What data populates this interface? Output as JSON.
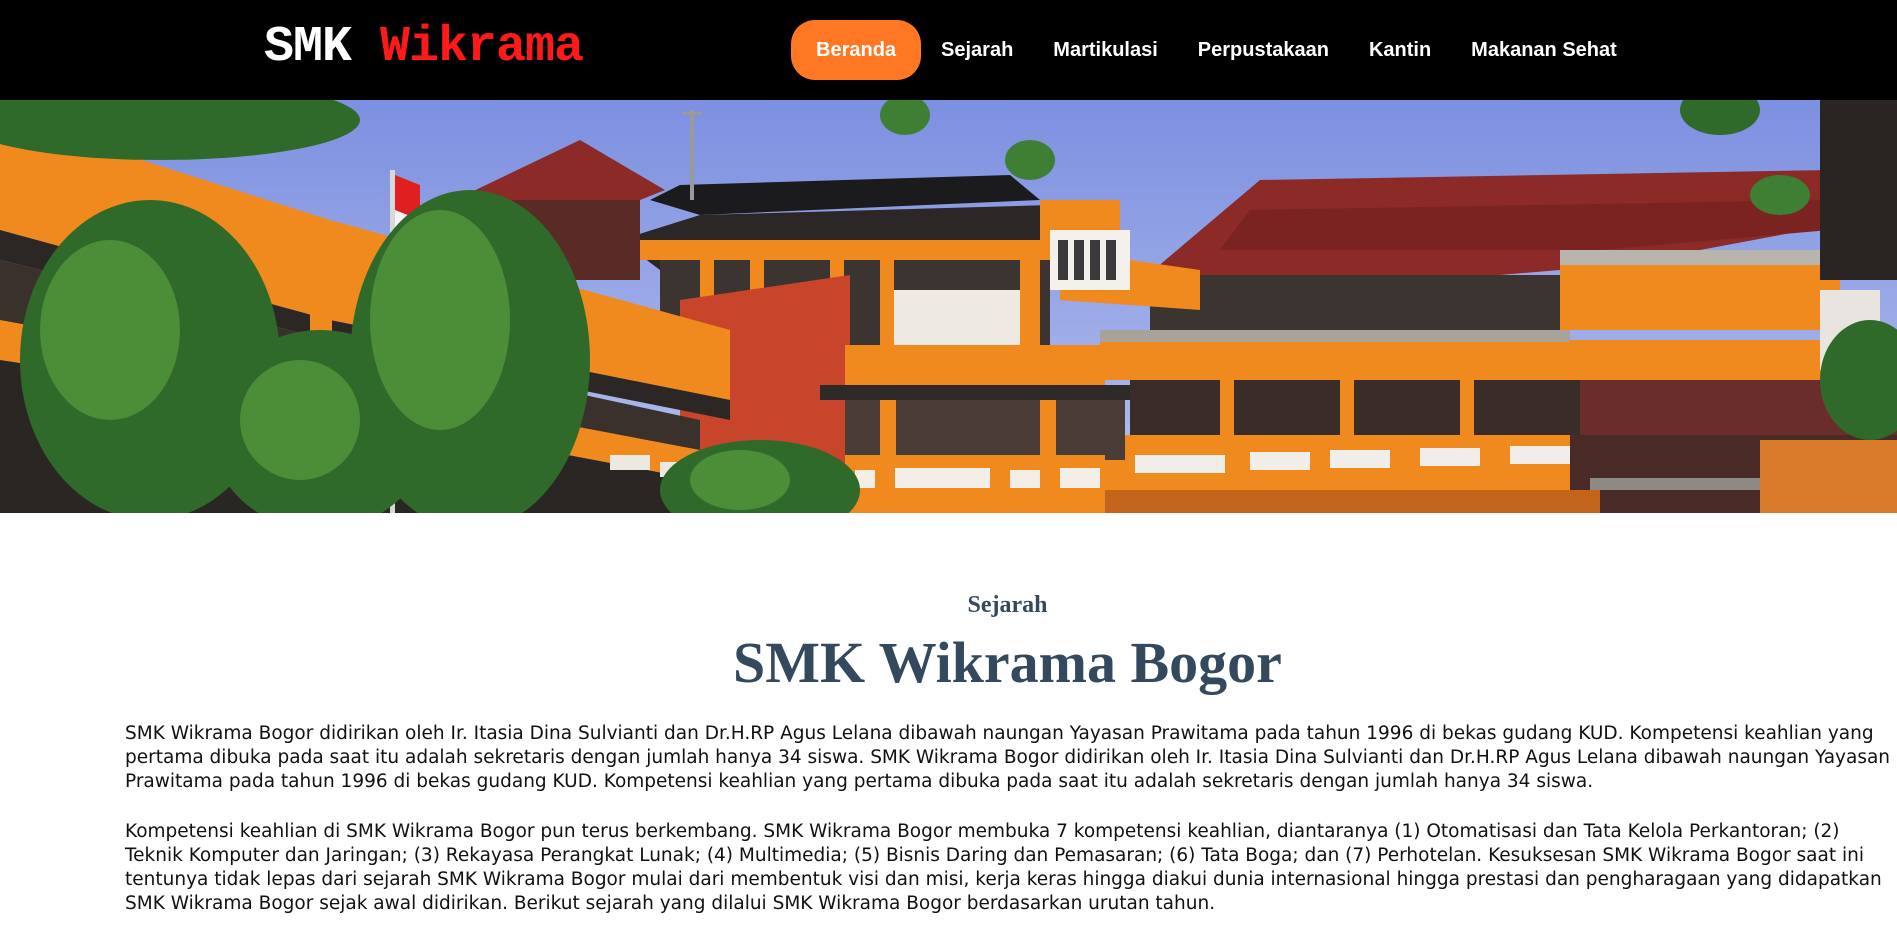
{
  "header": {
    "logo_part1": "SMK",
    "logo_part2": "Wikrama",
    "nav": [
      {
        "label": "Beranda",
        "active": true
      },
      {
        "label": "Sejarah"
      },
      {
        "label": "Martikulasi"
      },
      {
        "label": "Perpustakaan"
      },
      {
        "label": "Kantin"
      },
      {
        "label": "Makanan Sehat"
      }
    ]
  },
  "main": {
    "eyebrow": "Sejarah",
    "title": "SMK Wikrama Bogor",
    "paragraphs": [
      "SMK Wikrama Bogor didirikan oleh Ir. Itasia Dina Sulvianti dan Dr.H.RP Agus Lelana dibawah naungan Yayasan Prawitama pada tahun 1996 di bekas gudang KUD. Kompetensi keahlian yang pertama dibuka pada saat itu adalah sekretaris dengan jumlah hanya 34 siswa. SMK Wikrama Bogor didirikan oleh Ir. Itasia Dina Sulvianti dan Dr.H.RP Agus Lelana dibawah naungan Yayasan Prawitama pada tahun 1996 di bekas gudang KUD. Kompetensi keahlian yang pertama dibuka pada saat itu adalah sekretaris dengan jumlah hanya 34 siswa.",
      "Kompetensi keahlian di SMK Wikrama Bogor pun terus berkembang. SMK Wikrama Bogor membuka 7 kompetensi keahlian, diantaranya (1) Otomatisasi dan Tata Kelola Perkantoran; (2) Teknik Komputer dan Jaringan; (3) Rekayasa Perangkat Lunak; (4) Multimedia; (5) Bisnis Daring dan Pemasaran; (6) Tata Boga; dan (7) Perhotelan. Kesuksesan SMK Wikrama Bogor saat ini tentunya tidak lepas dari sejarah SMK Wikrama Bogor mulai dari membentuk visi dan misi, kerja keras hingga diakui dunia internasional hingga prestasi dan pengharagaan yang didapatkan SMK Wikrama Bogor sejak awal didirikan. Berikut sejarah yang dilalui SMK Wikrama Bogor berdasarkan urutan tahun."
    ]
  },
  "colors": {
    "nav_bg": "#000000",
    "accent": "#ff7722",
    "logo_red": "#ff1a1a",
    "heading": "#34495e",
    "building_orange": "#f08a1e",
    "roof_red": "#8b2a26"
  },
  "hero_image": "school-building-photo"
}
